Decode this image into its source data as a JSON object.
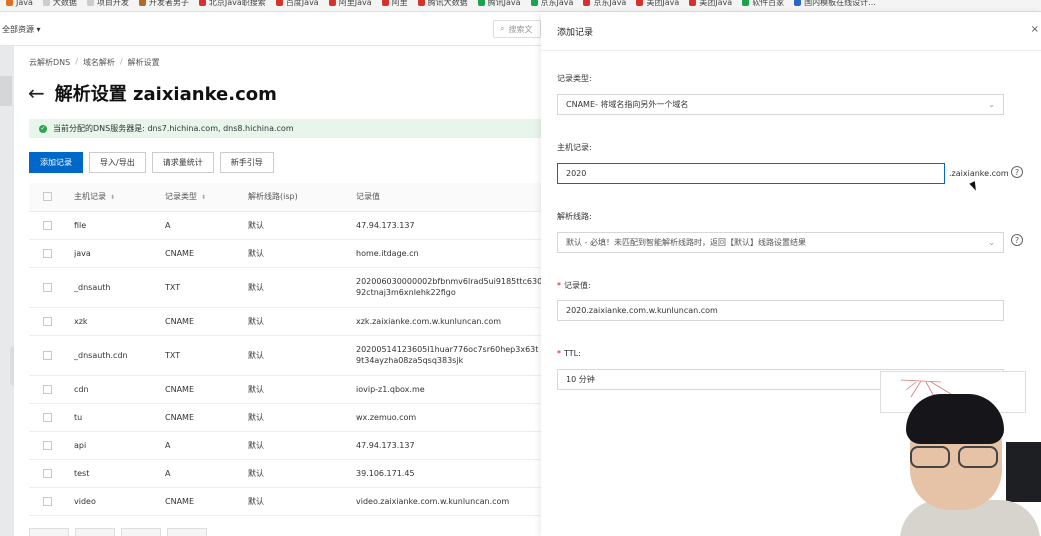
{
  "bookmarks": [
    {
      "label": "Java",
      "color": "#e07020"
    },
    {
      "label": "大数据",
      "color": "#cccccc"
    },
    {
      "label": "项目开发",
      "color": "#cccccc"
    },
    {
      "label": "开发者男子",
      "color": "#b36a1e"
    },
    {
      "label": "北京Java职搜索",
      "color": "#d6322a"
    },
    {
      "label": "百度Java",
      "color": "#d6322a"
    },
    {
      "label": "阿里Java",
      "color": "#d6322a"
    },
    {
      "label": "阿里",
      "color": "#d6322a"
    },
    {
      "label": "腾讯大数据",
      "color": "#d6322a"
    },
    {
      "label": "腾讯Java",
      "color": "#1aa34a"
    },
    {
      "label": "京东Java",
      "color": "#1aa34a"
    },
    {
      "label": "京东Java",
      "color": "#d6322a"
    },
    {
      "label": "美团Java",
      "color": "#d6322a"
    },
    {
      "label": "美团Java",
      "color": "#d6322a"
    },
    {
      "label": "软件百家",
      "color": "#1aa34a"
    },
    {
      "label": "国内模板在线设计...",
      "color": "#2a66c8"
    }
  ],
  "topnav": {
    "resource_select": "全部资源",
    "search_placeholder": "搜索文"
  },
  "breadcrumb": [
    "云解析DNS",
    "域名解析",
    "解析设置"
  ],
  "page_title": "解析设置 zaixianke.com",
  "dns_notice": "当前分配的DNS服务器是: dns7.hichina.com, dns8.hichina.com",
  "buttons": {
    "add": "添加记录",
    "import_export": "导入/导出",
    "request_stats": "请求量统计",
    "guide": "新手引导"
  },
  "table": {
    "headers": {
      "host": "主机记录",
      "type": "记录类型",
      "line": "解析线路(isp)",
      "value": "记录值"
    },
    "rows": [
      {
        "host": "file",
        "type": "A",
        "line": "默认",
        "value": "47.94.173.137",
        "value2": ""
      },
      {
        "host": "java",
        "type": "CNAME",
        "line": "默认",
        "value": "home.itdage.cn",
        "value2": ""
      },
      {
        "host": "_dnsauth",
        "type": "TXT",
        "line": "默认",
        "value": "202006030000002bfbnmv6lrad5ui9185ttc630",
        "value2": "92ctnaj3m6xnlehk22figo"
      },
      {
        "host": "xzk",
        "type": "CNAME",
        "line": "默认",
        "value": "xzk.zaixianke.com.w.kunluncan.com",
        "value2": ""
      },
      {
        "host": "_dnsauth.cdn",
        "type": "TXT",
        "line": "默认",
        "value": "20200514123605l1huar776oc7sr60hep3x63t",
        "value2": "9t34ayzha08za5qsq383sjk"
      },
      {
        "host": "cdn",
        "type": "CNAME",
        "line": "默认",
        "value": "iovip-z1.qbox.me",
        "value2": ""
      },
      {
        "host": "tu",
        "type": "CNAME",
        "line": "默认",
        "value": "wx.zemuo.com",
        "value2": ""
      },
      {
        "host": "api",
        "type": "A",
        "line": "默认",
        "value": "47.94.173.137",
        "value2": ""
      },
      {
        "host": "test",
        "type": "A",
        "line": "默认",
        "value": "39.106.171.45",
        "value2": ""
      },
      {
        "host": "video",
        "type": "CNAME",
        "line": "默认",
        "value": "video.zaixianke.com.w.kunluncan.com",
        "value2": ""
      }
    ]
  },
  "drawer": {
    "title": "添加记录",
    "close_label": "×",
    "record_type_label": "记录类型:",
    "record_type_value": "CNAME- 将域名指向另外一个域名",
    "host_label": "主机记录:",
    "host_value": "2020",
    "host_suffix": ".zaixianke.com",
    "line_label": "解析线路:",
    "line_value": "默认 - 必填！未匹配到智能解析线路时，返回【默认】线路设置结果",
    "value_label": "记录值:",
    "value_value": "2020.zaixianke.com.w.kunluncan.com",
    "ttl_label": "TTL:",
    "ttl_value": "10 分钟",
    "required_mark": "*",
    "help_glyph": "?"
  },
  "colors": {
    "primary": "#0068c8",
    "success": "#2da44e",
    "required": "#dd0000"
  }
}
